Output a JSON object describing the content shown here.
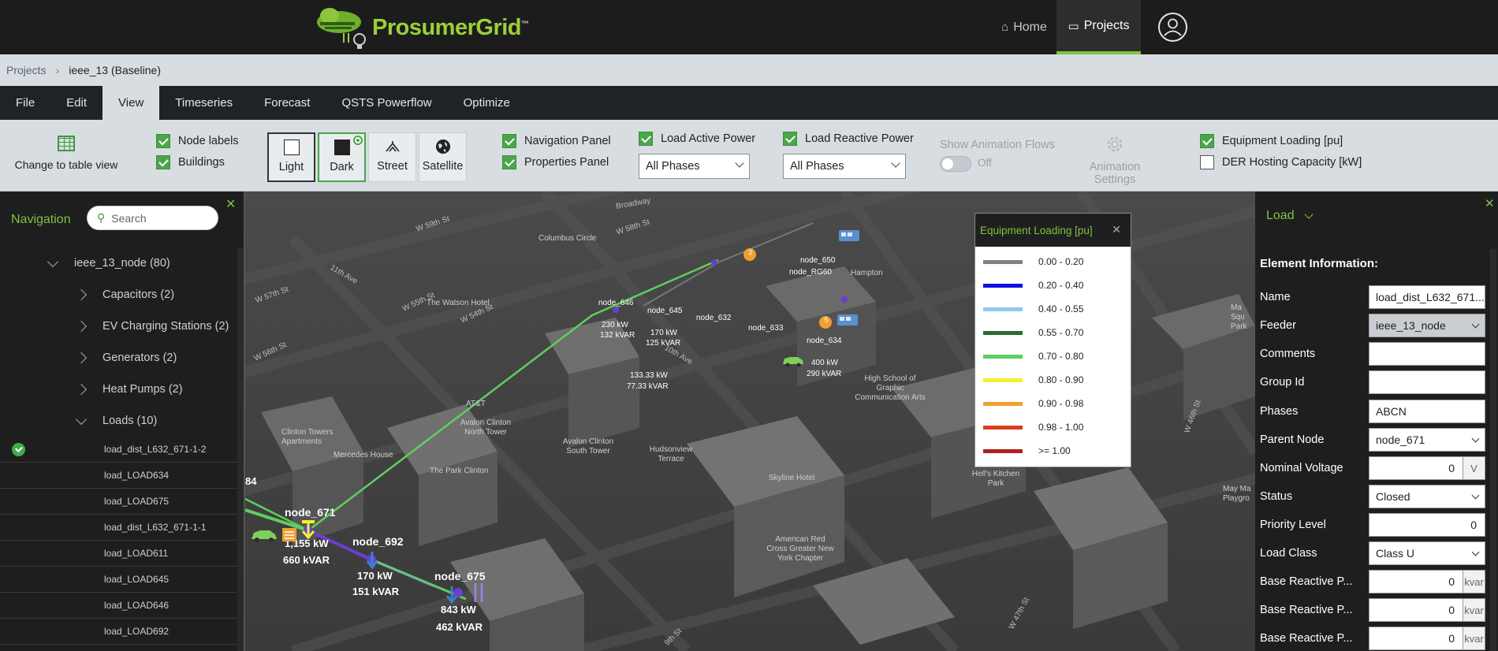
{
  "app": {
    "name": "ProsumerGrid",
    "tm": "™",
    "nav": [
      {
        "label": "Home",
        "icon": "home-icon"
      },
      {
        "label": "Projects",
        "icon": "folder-icon"
      }
    ]
  },
  "breadcrumb": {
    "root": "Projects",
    "current": "ieee_13 (Baseline)"
  },
  "menu": [
    "File",
    "Edit",
    "View",
    "Timeseries",
    "Forecast",
    "QSTS Powerflow",
    "Optimize"
  ],
  "toolbar": {
    "table_view": "Change to table view",
    "node_labels": "Node labels",
    "buildings": "Buildings",
    "map_styles": [
      "Light",
      "Dark",
      "Street",
      "Satellite"
    ],
    "navigation_panel": "Navigation Panel",
    "properties_panel": "Properties Panel",
    "load_active": "Load Active Power",
    "load_active_select": "All Phases",
    "load_reactive": "Load Reactive Power",
    "load_reactive_select": "All Phases",
    "animation_flows": "Show Animation Flows",
    "animation_state": "Off",
    "animation_settings": "Animation Settings",
    "equipment_loading": "Equipment Loading [pu]",
    "der_hosting": "DER Hosting Capacity [kW]"
  },
  "navigation": {
    "title": "Navigation",
    "search_placeholder": "Search",
    "root": "ieee_13_node (80)",
    "groups": [
      "Capacitors (2)",
      "EV Charging Stations (2)",
      "Generators (2)",
      "Heat Pumps (2)",
      "Loads (10)"
    ],
    "loads": [
      "load_dist_L632_671-1-2",
      "load_LOAD634",
      "load_LOAD675",
      "load_dist_L632_671-1-1",
      "load_LOAD611",
      "load_LOAD645",
      "load_LOAD646",
      "load_LOAD692"
    ]
  },
  "map": {
    "streets": [
      "W 57th St",
      "W 56th St",
      "W 54th St",
      "W 55th St",
      "10th Ave",
      "11th Ave",
      "W 47th St",
      "W 46th St",
      "9th St",
      "W 59th St",
      "W 58th St",
      "Broadway"
    ],
    "places": [
      "Clinton Towers Apartments",
      "Mercedes House",
      "The Park Clinton",
      "Avalon Clinton North Tower",
      "Avalon Clinton South Tower",
      "Hudsonview Terrace",
      "Skyline Hotel",
      "American Red Cross Greater New York Chapter",
      "Hell's Kitchen Park",
      "High School of Graphic Communication Arts",
      "AT&T",
      "The Watson Hotel",
      "Columbus Circle",
      "Hampton",
      "May Ma Playgro",
      "Ma Squ Park"
    ],
    "nodes": [
      {
        "id": "node_671",
        "kw": "1,155 kW",
        "kvar": "660 kVAR"
      },
      {
        "id": "node_692",
        "kw": "170 kW",
        "kvar": "151 kVAR"
      },
      {
        "id": "node_675",
        "kw": "843 kW",
        "kvar": "462 kVAR"
      },
      {
        "id": "node_646",
        "kw": "230 kW",
        "kvar": "132 kVAR"
      },
      {
        "id": "node_645",
        "kw": "170 kW",
        "kvar": "125 kVAR"
      },
      {
        "id": "node_632",
        "kw": "133.33 kW",
        "kvar": "77.33 kVAR"
      },
      {
        "id": "node_633",
        "kw": "",
        "kvar": ""
      },
      {
        "id": "node_634",
        "kw": "400 kW",
        "kvar": "290 kVAR"
      },
      {
        "id": "node_650",
        "kw": "",
        "kvar": ""
      },
      {
        "id": "node_RG60",
        "kw": "",
        "kvar": ""
      }
    ],
    "edge_label": "84",
    "badge_a": "2",
    "badge_b": "5"
  },
  "legend": {
    "title": "Equipment Loading [pu]",
    "rows": [
      {
        "label": "0.00 - 0.20",
        "color": "#808080"
      },
      {
        "label": "0.20 - 0.40",
        "color": "#1010e0"
      },
      {
        "label": "0.40 - 0.55",
        "color": "#8ec9ea"
      },
      {
        "label": "0.55 - 0.70",
        "color": "#2e6b2e"
      },
      {
        "label": "0.70 - 0.80",
        "color": "#5ed05e"
      },
      {
        "label": "0.80 - 0.90",
        "color": "#f4f030"
      },
      {
        "label": "0.90 - 0.98",
        "color": "#f0a030"
      },
      {
        "label": "0.98 - 1.00",
        "color": "#d84020"
      },
      {
        "label": ">= 1.00",
        "color": "#b02020"
      }
    ]
  },
  "properties": {
    "type": "Load",
    "section": "Element Information:",
    "fields": [
      {
        "label": "Name",
        "value": "load_dist_L632_671...",
        "kind": "text"
      },
      {
        "label": "Feeder",
        "value": "ieee_13_node",
        "kind": "select-grey"
      },
      {
        "label": "Comments",
        "value": "",
        "kind": "text"
      },
      {
        "label": "Group Id",
        "value": "",
        "kind": "text"
      },
      {
        "label": "Phases",
        "value": "ABCN",
        "kind": "text"
      },
      {
        "label": "Parent Node",
        "value": "node_671",
        "kind": "select"
      },
      {
        "label": "Nominal Voltage",
        "value": "0",
        "kind": "num-unit",
        "unit": "V"
      },
      {
        "label": "Status",
        "value": "Closed",
        "kind": "select"
      },
      {
        "label": "Priority Level",
        "value": "0",
        "kind": "num"
      },
      {
        "label": "Load Class",
        "value": "Class U",
        "kind": "select"
      },
      {
        "label": "Base Reactive P...",
        "value": "0",
        "kind": "num-unit",
        "unit": "kvar"
      },
      {
        "label": "Base Reactive P...",
        "value": "0",
        "kind": "num-unit",
        "unit": "kvar"
      },
      {
        "label": "Base Reactive P...",
        "value": "0",
        "kind": "num-unit",
        "unit": "kvar"
      }
    ]
  },
  "colors": {
    "accent": "#7fc241",
    "background": "#1e1e1e",
    "toolbar": "#d8dde2"
  }
}
